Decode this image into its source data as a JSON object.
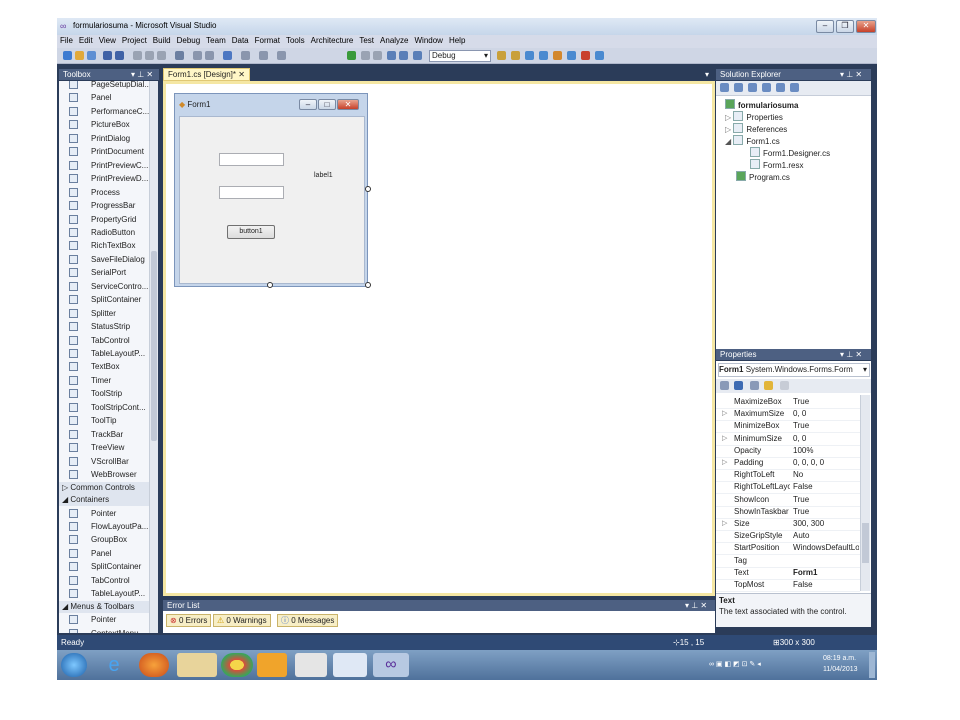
{
  "window": {
    "title": "formulariosuma - Microsoft Visual Studio",
    "controls": [
      "minimize",
      "maximize",
      "close"
    ]
  },
  "menu": [
    "File",
    "Edit",
    "View",
    "Project",
    "Build",
    "Debug",
    "Team",
    "Data",
    "Format",
    "Tools",
    "Architecture",
    "Test",
    "Analyze",
    "Window",
    "Help"
  ],
  "toolbar": {
    "config_select": "Debug"
  },
  "toolbox": {
    "title": "Toolbox",
    "items_top": [
      "PageSetupDial...",
      "Panel",
      "PerformanceC...",
      "PictureBox",
      "PrintDialog",
      "PrintDocument",
      "PrintPreviewC...",
      "PrintPreviewD...",
      "Process",
      "ProgressBar",
      "PropertyGrid",
      "RadioButton",
      "RichTextBox",
      "SaveFileDialog",
      "SerialPort",
      "ServiceContro...",
      "SplitContainer",
      "Splitter",
      "StatusStrip",
      "TabControl",
      "TableLayoutP...",
      "TextBox",
      "Timer",
      "ToolStrip",
      "ToolStripCont...",
      "ToolTip",
      "TrackBar",
      "TreeView",
      "VScrollBar",
      "WebBrowser"
    ],
    "group_common": "Common Controls",
    "group_containers": "Containers",
    "items_containers": [
      "Pointer",
      "FlowLayoutPa...",
      "GroupBox",
      "Panel",
      "SplitContainer",
      "TabControl",
      "TableLayoutP..."
    ],
    "group_menus": "Menus & Toolbars",
    "items_menus": [
      "Pointer",
      "ContextMenu..."
    ]
  },
  "document": {
    "tab_label": "Form1.cs [Design]*",
    "form_title": "Form1",
    "label_text": "label1",
    "button_text": "button1"
  },
  "solution_explorer": {
    "title": "Solution Explorer",
    "items": [
      "formulariosuma",
      "Properties",
      "References",
      "Form1.cs",
      "Form1.Designer.cs",
      "Form1.resx",
      "Program.cs"
    ]
  },
  "properties": {
    "title": "Properties",
    "object_name": "Form1",
    "object_type": "System.Windows.Forms.Form",
    "rows": [
      {
        "name": "MaximizeBox",
        "value": "True"
      },
      {
        "name": "MaximumSize",
        "value": "0, 0"
      },
      {
        "name": "MinimizeBox",
        "value": "True"
      },
      {
        "name": "MinimumSize",
        "value": "0, 0"
      },
      {
        "name": "Opacity",
        "value": "100%"
      },
      {
        "name": "Padding",
        "value": "0, 0, 0, 0"
      },
      {
        "name": "RightToLeft",
        "value": "No"
      },
      {
        "name": "RightToLeftLayo",
        "value": "False"
      },
      {
        "name": "ShowIcon",
        "value": "True"
      },
      {
        "name": "ShowInTaskbar",
        "value": "True"
      },
      {
        "name": "Size",
        "value": "300, 300"
      },
      {
        "name": "SizeGripStyle",
        "value": "Auto"
      },
      {
        "name": "StartPosition",
        "value": "WindowsDefaultLo"
      },
      {
        "name": "Tag",
        "value": ""
      },
      {
        "name": "Text",
        "value": "Form1"
      },
      {
        "name": "TopMost",
        "value": "False"
      }
    ],
    "desc_title": "Text",
    "desc_text": "The text associated with the control."
  },
  "error_list": {
    "title": "Error List",
    "errors": "0 Errors",
    "warnings": "0 Warnings",
    "messages": "0 Messages"
  },
  "status": {
    "ready": "Ready",
    "position": "15 , 15",
    "size": "300 x 300"
  },
  "taskbar": {
    "time": "08:19 a.m.",
    "date": "11/04/2013"
  },
  "colors": {
    "ide_frame": "#2b3c59",
    "doc_tab": "#fff7c7",
    "status_bar": "#2f4a75"
  }
}
